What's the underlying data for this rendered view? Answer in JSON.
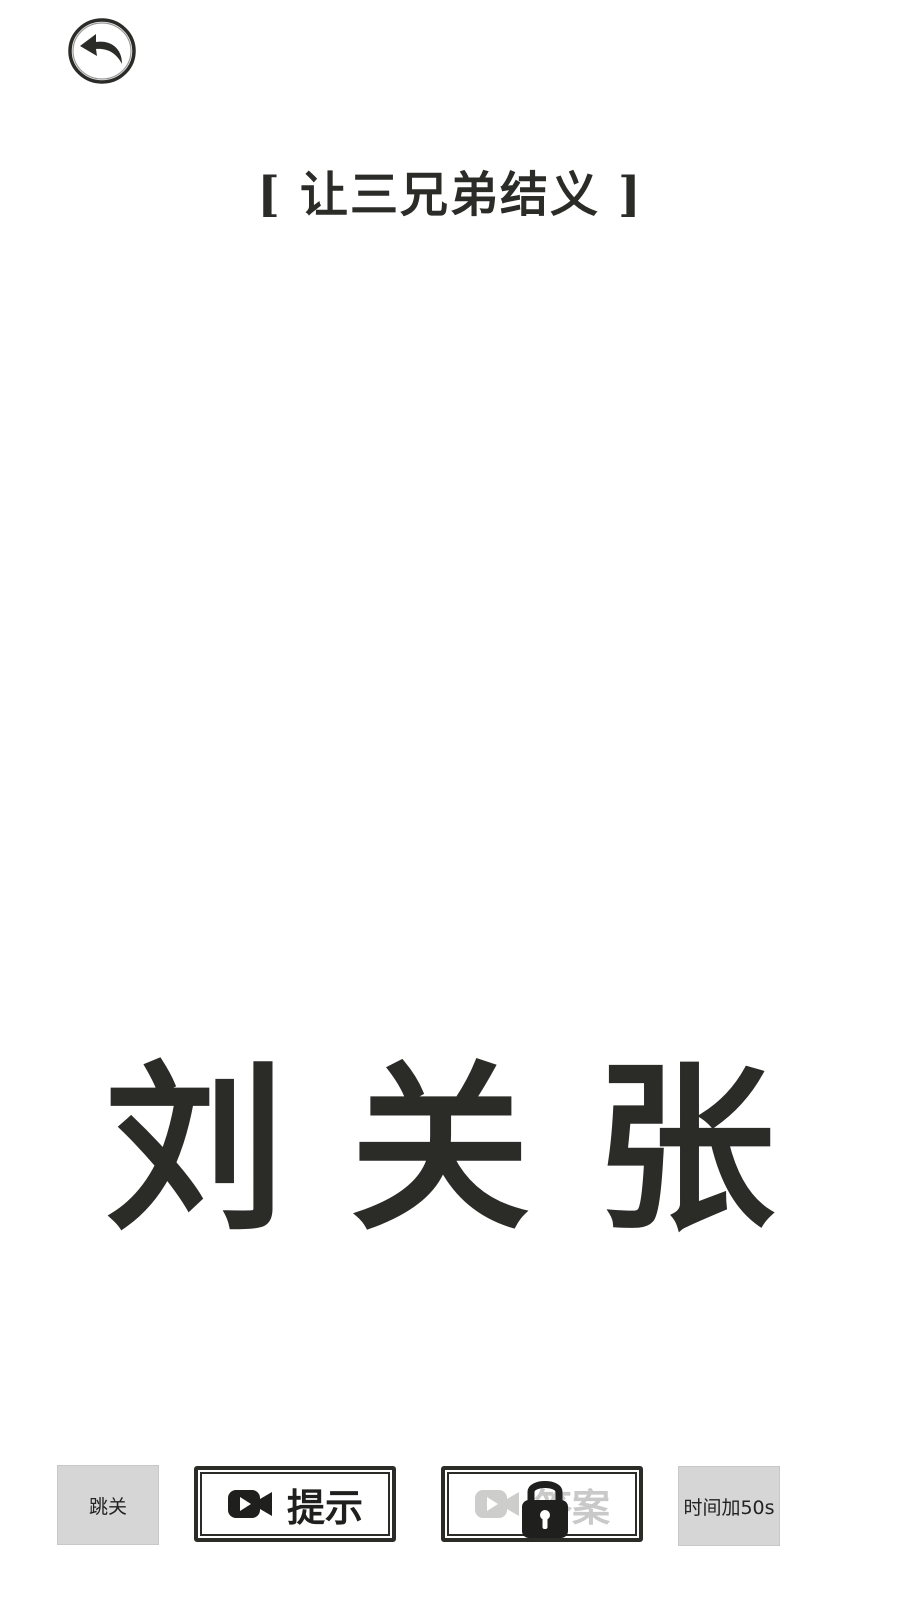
{
  "level": {
    "title": "让三兄弟结义",
    "bracket_left": "[",
    "bracket_right": "]"
  },
  "characters": [
    "刘",
    "关",
    "张"
  ],
  "buttons": {
    "skip": "跳关",
    "hint": "提示",
    "answer": "答案",
    "add_time": "时间加50s"
  },
  "icons": {
    "back": "back-arrow-icon",
    "video": "video-camera-icon",
    "lock": "lock-icon"
  },
  "colors": {
    "ink": "#2b2b28",
    "button_gray": "#d6d6d6",
    "disabled_text": "#c9c9c9"
  }
}
